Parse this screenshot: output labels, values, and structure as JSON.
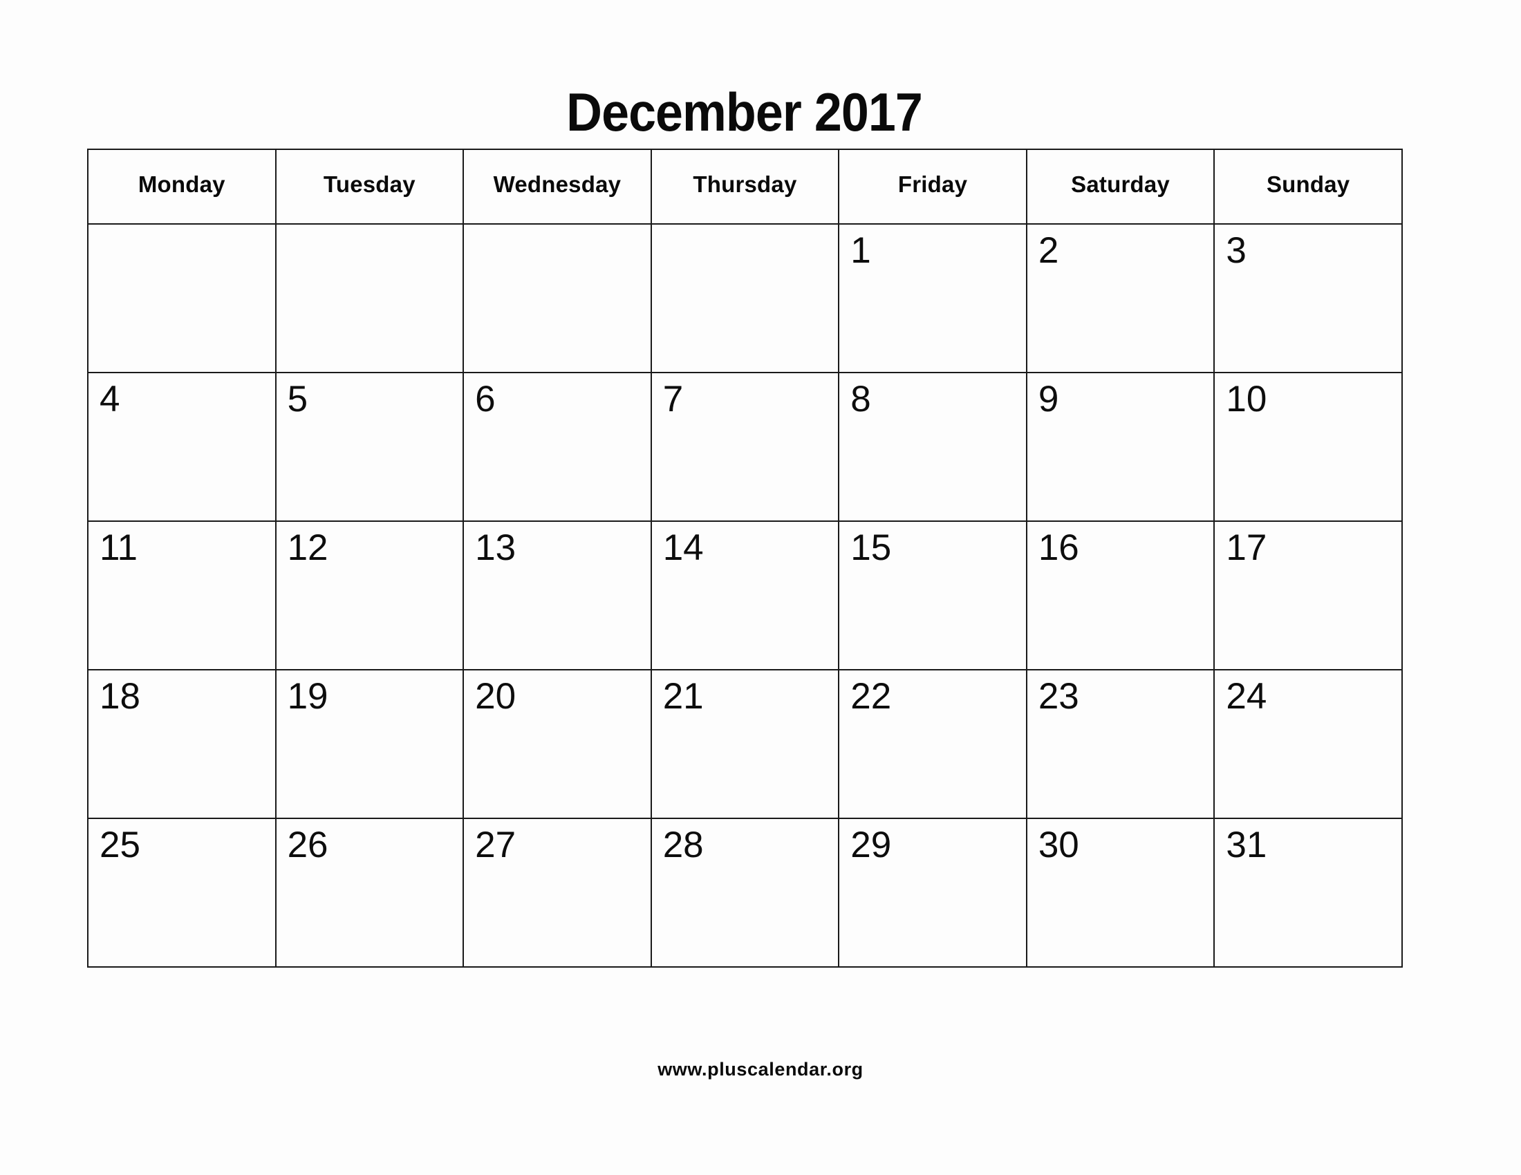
{
  "calendar": {
    "title": "December 2017",
    "month": "December",
    "year": "2017",
    "first_day_of_week": "Monday",
    "weekday_headers": [
      "Monday",
      "Tuesday",
      "Wednesday",
      "Thursday",
      "Friday",
      "Saturday",
      "Sunday"
    ],
    "weeks": [
      [
        "",
        "",
        "",
        "",
        "1",
        "2",
        "3"
      ],
      [
        "4",
        "5",
        "6",
        "7",
        "8",
        "9",
        "10"
      ],
      [
        "11",
        "12",
        "13",
        "14",
        "15",
        "16",
        "17"
      ],
      [
        "18",
        "19",
        "20",
        "21",
        "22",
        "23",
        "24"
      ],
      [
        "25",
        "26",
        "27",
        "28",
        "29",
        "30",
        "31"
      ]
    ]
  },
  "footer": {
    "website": "www.pluscalendar.org"
  },
  "colors": {
    "page_background": "#fdfdfd",
    "grid_line": "#1a1a1a",
    "text": "#0a0a0a"
  }
}
